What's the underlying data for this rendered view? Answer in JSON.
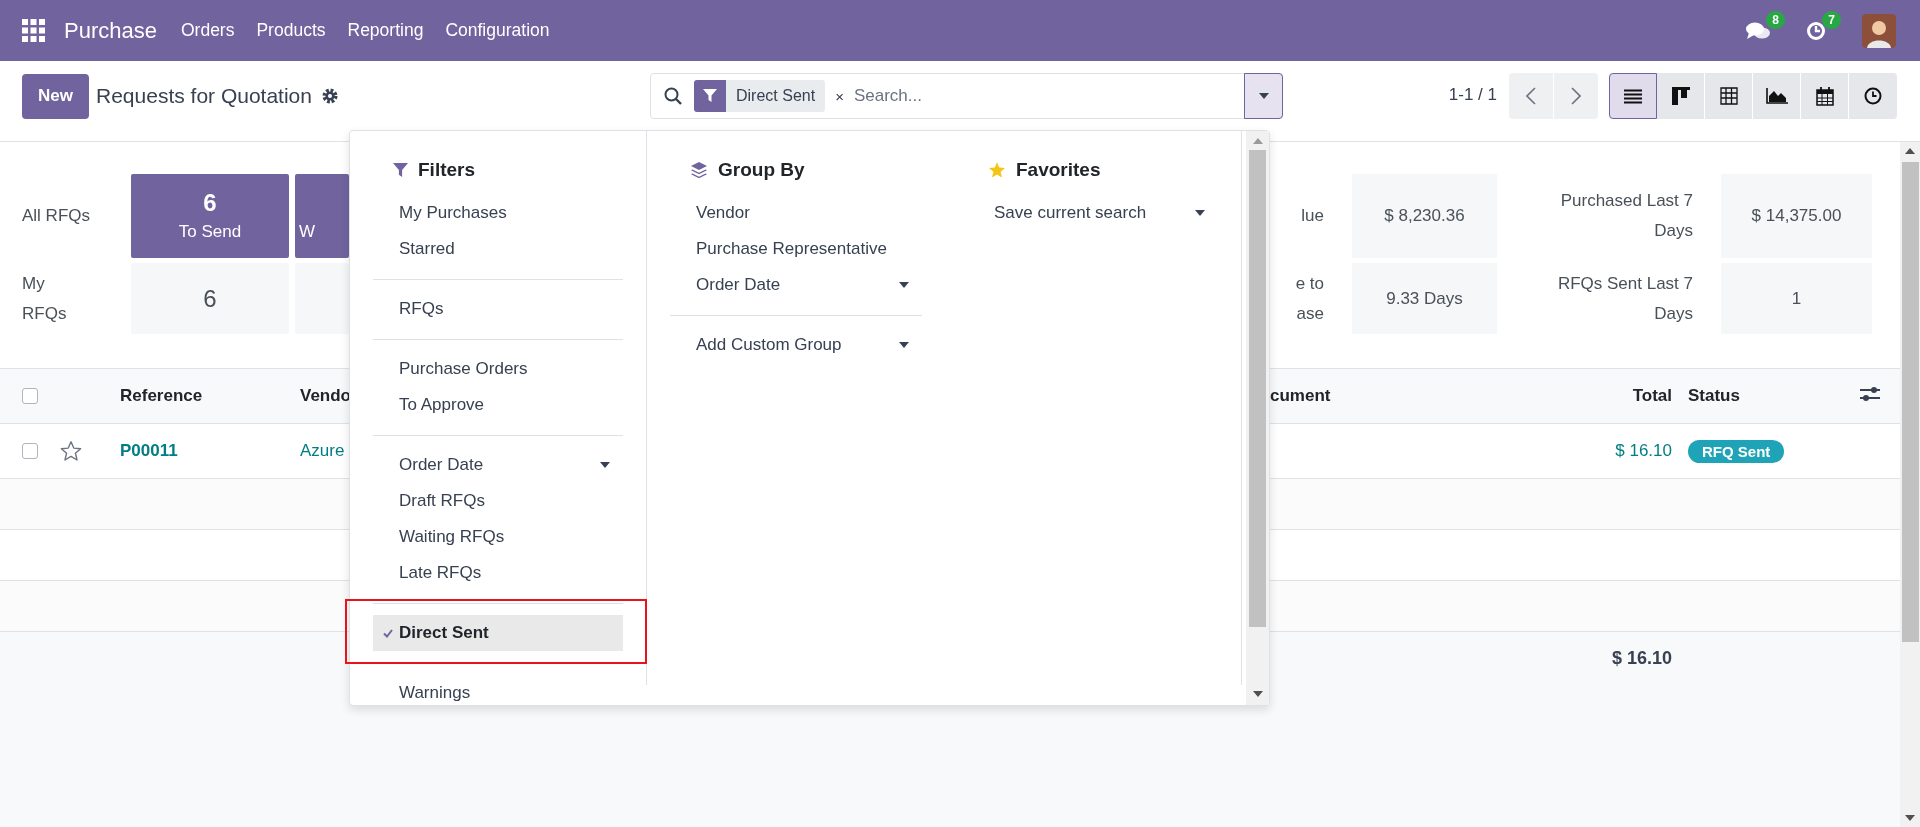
{
  "navbar": {
    "app": "Purchase",
    "menu": [
      "Orders",
      "Products",
      "Reporting",
      "Configuration"
    ],
    "messages_badge": "8",
    "activities_badge": "7"
  },
  "control_panel": {
    "new_button": "New",
    "title": "Requests for Quotation",
    "search": {
      "facets": [
        {
          "label": "Direct Sent",
          "remove": "×"
        }
      ],
      "placeholder": "Search..."
    },
    "pager": "1-1 / 1",
    "views": [
      {
        "kind": "list",
        "selected": true
      },
      {
        "kind": "kanban",
        "selected": false
      },
      {
        "kind": "pivot",
        "selected": false
      },
      {
        "kind": "graph",
        "selected": false
      },
      {
        "kind": "calendar",
        "selected": false
      },
      {
        "kind": "activity",
        "selected": false
      }
    ]
  },
  "dashboard": {
    "row_labels": [
      "All RFQs",
      "My RFQs"
    ],
    "tiles": [
      [
        {
          "kind": "highlight",
          "value": "6",
          "label": "To Send"
        },
        {
          "kind": "highlight",
          "label": "W"
        }
      ],
      [
        {
          "kind": "plain",
          "value": "6"
        },
        {
          "kind": "plain"
        }
      ]
    ],
    "stats": [
      {
        "label_lines": [
          "lue"
        ],
        "value": "$ 8,230.36",
        "label_2": "Purchased Last 7 Days",
        "value_2": "$ 14,375.00"
      },
      {
        "label_lines": [
          "e to",
          "ase"
        ],
        "value": "9.33 Days",
        "label_2": "RFQs Sent Last 7 Days",
        "value_2": "1"
      }
    ]
  },
  "table": {
    "select_all_checked": false,
    "columns": [
      {
        "kind": "reference",
        "label": "Reference"
      },
      {
        "kind": "vendor",
        "label": "Vendo"
      },
      {
        "kind": "source",
        "label": "cument"
      },
      {
        "kind": "total",
        "label": "Total"
      },
      {
        "kind": "status",
        "label": "Status"
      }
    ],
    "rows": [
      {
        "checked": false,
        "starred": false,
        "reference": "P00011",
        "vendor": "Azure",
        "total": "$ 16.10",
        "status": "RFQ Sent"
      }
    ],
    "footer_total": "$ 16.10"
  },
  "search_panel": {
    "filters": {
      "title": "Filters",
      "groups": [
        [
          {
            "label": "My Purchases",
            "kind": "option",
            "selected": false
          },
          {
            "label": "Starred",
            "kind": "option",
            "selected": false
          }
        ],
        [
          {
            "label": "RFQs",
            "kind": "option",
            "selected": false
          }
        ],
        [
          {
            "label": "Purchase Orders",
            "kind": "option",
            "selected": false
          },
          {
            "label": "To Approve",
            "kind": "option",
            "selected": false
          }
        ],
        [
          {
            "label": "Order Date",
            "kind": "submenu",
            "selected": false
          },
          {
            "label": "Draft RFQs",
            "kind": "option",
            "selected": false
          },
          {
            "label": "Waiting RFQs",
            "kind": "option",
            "selected": false
          },
          {
            "label": "Late RFQs",
            "kind": "option",
            "selected": false
          }
        ],
        [
          {
            "label": "Direct Sent",
            "kind": "option",
            "selected": true,
            "outlined": true
          }
        ],
        [
          {
            "label": "Warnings",
            "kind": "option",
            "selected": false
          }
        ]
      ]
    },
    "group_by": {
      "title": "Group By",
      "groups": [
        [
          {
            "label": "Vendor",
            "kind": "option",
            "selected": false
          },
          {
            "label": "Purchase Representative",
            "kind": "option",
            "selected": false
          },
          {
            "label": "Order Date",
            "kind": "submenu",
            "selected": false
          }
        ],
        [
          {
            "label": "Add Custom Group",
            "kind": "submenu",
            "selected": false
          }
        ]
      ]
    },
    "favorites": {
      "title": "Favorites",
      "groups": [
        [
          {
            "label": "Save current search",
            "kind": "submenu"
          }
        ]
      ]
    }
  }
}
